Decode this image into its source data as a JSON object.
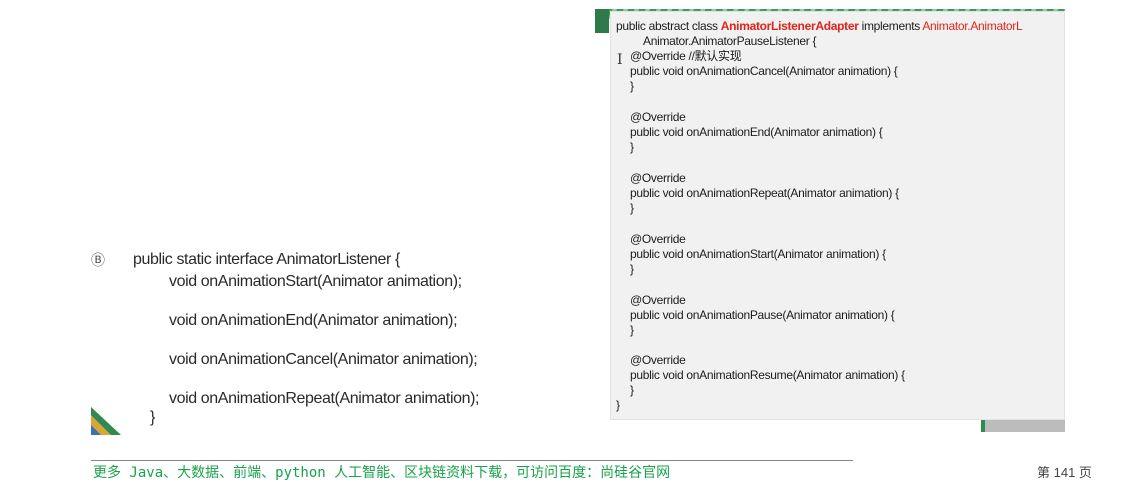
{
  "left_code": {
    "l1": "public static interface AnimatorListener {",
    "l2": "void onAnimationStart(Animator animation);",
    "l3": "void onAnimationEnd(Animator animation);",
    "l4": "void onAnimationCancel(Animator animation);",
    "l5": "void onAnimationRepeat(Animator animation);",
    "l6": "}"
  },
  "right_code": {
    "l1_prefix": "public abstract class ",
    "l1_class": "AnimatorListenerAdapter",
    "l1_mid": " implements ",
    "l1_iface": "Animator.AnimatorL",
    "l2": "Animator.AnimatorPauseListener {",
    "l3": "@Override //默认实现",
    "l4": "public void onAnimationCancel(Animator animation) {",
    "l5": "}",
    "l6": "@Override",
    "l7": "public void onAnimationEnd(Animator animation) {",
    "l8": "}",
    "l9": "@Override",
    "l10": "public void onAnimationRepeat(Animator animation) {",
    "l11": "}",
    "l12": "@Override",
    "l13": "public void onAnimationStart(Animator animation) {",
    "l14": "}",
    "l15": "@Override",
    "l16": "public void onAnimationPause(Animator animation) {",
    "l17": "}",
    "l18": "@Override",
    "l19": "public void onAnimationResume(Animator animation) {",
    "l20": "}",
    "l21": "}"
  },
  "footer": {
    "text": "更多 Java、大数据、前端、python 人工智能、区块链资料下载，可访问百度：尚硅谷官网",
    "page": "第 141 页"
  },
  "colors": {
    "accent_green": "#2f7a4a",
    "highlight_red": "#e2231a",
    "footer_green": "#18a34a"
  },
  "icons": {
    "bullet": "ribbon-bullet-icon",
    "cursor": "text-cursor-icon",
    "corner": "slide-corner-decoration-icon"
  }
}
